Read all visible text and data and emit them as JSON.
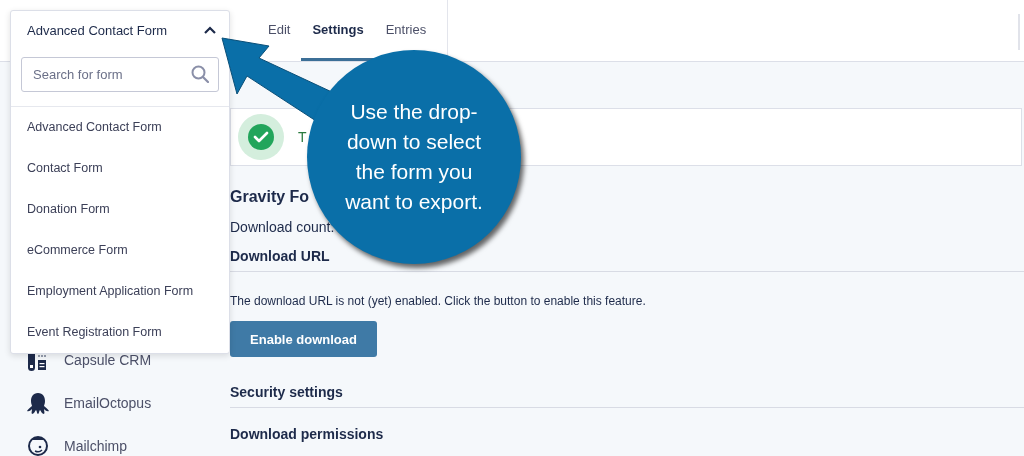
{
  "form_selector": {
    "value": "Advanced Contact Form",
    "expanded": true,
    "search": {
      "placeholder": "Search for form"
    },
    "options": [
      "Advanced Contact Form",
      "Contact Form",
      "Donation Form",
      "eCommerce Form",
      "Employment Application Form",
      "Event Registration Form"
    ]
  },
  "tabs": [
    {
      "label": "Edit",
      "selected": false
    },
    {
      "label": "Settings",
      "selected": true
    },
    {
      "label": "Entries",
      "selected": false
    }
  ],
  "sidebar": {
    "items": [
      {
        "label": "Capsule CRM"
      },
      {
        "label": "EmailOctopus"
      },
      {
        "label": "Mailchimp"
      }
    ]
  },
  "notice": {
    "text": "T"
  },
  "content": {
    "heading": "Gravity Fo",
    "count_label": "Download count:",
    "download_url": {
      "heading": "Download URL",
      "text": "The download URL is not (yet) enabled. Click the button to enable this feature.",
      "button": "Enable download"
    },
    "security": {
      "heading": "Security settings",
      "subheading": "Download permissions"
    }
  },
  "callout": {
    "text": "Use the drop-down to select the form you want to export."
  }
}
